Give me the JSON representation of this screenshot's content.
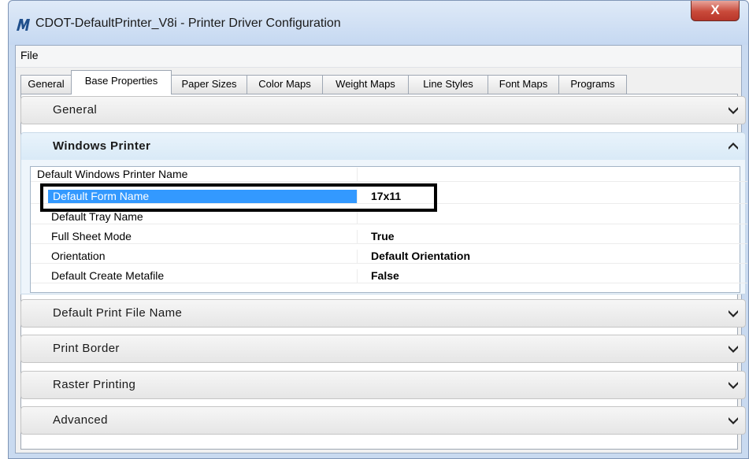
{
  "window": {
    "title": "CDOT-DefaultPrinter_V8i - Printer Driver Configuration",
    "close_label": "X"
  },
  "menu": {
    "items": [
      {
        "label": "File"
      }
    ]
  },
  "tabs": [
    {
      "label": "General"
    },
    {
      "label": "Base Properties",
      "active": true
    },
    {
      "label": "Paper Sizes"
    },
    {
      "label": "Color Maps"
    },
    {
      "label": "Weight Maps"
    },
    {
      "label": "Line Styles"
    },
    {
      "label": "Font Maps"
    },
    {
      "label": "Programs"
    }
  ],
  "sections": {
    "general": {
      "label": "General",
      "expanded": false
    },
    "windows_printer": {
      "label": "Windows Printer",
      "expanded": true
    },
    "default_print_file_name": {
      "label": "Default Print File Name",
      "expanded": false
    },
    "print_border": {
      "label": "Print Border",
      "expanded": false
    },
    "raster_printing": {
      "label": "Raster Printing",
      "expanded": false
    },
    "advanced": {
      "label": "Advanced",
      "expanded": false
    }
  },
  "properties": [
    {
      "name": "Default Windows Printer Name",
      "value": ""
    },
    {
      "name": "Default Form Name",
      "value": "17x11",
      "selected": true
    },
    {
      "name": "Default Tray Name",
      "value": ""
    },
    {
      "name": "Full Sheet Mode",
      "value": "True"
    },
    {
      "name": "Orientation",
      "value": "Default Orientation"
    },
    {
      "name": "Default Create Metafile",
      "value": "False"
    }
  ],
  "icons": {
    "app": "microstation-logo-icon",
    "collapsed": "chevron-down-icon",
    "expanded": "chevron-up-icon"
  },
  "colors": {
    "selection": "#3399ff",
    "close_button": "#c94a3a"
  }
}
